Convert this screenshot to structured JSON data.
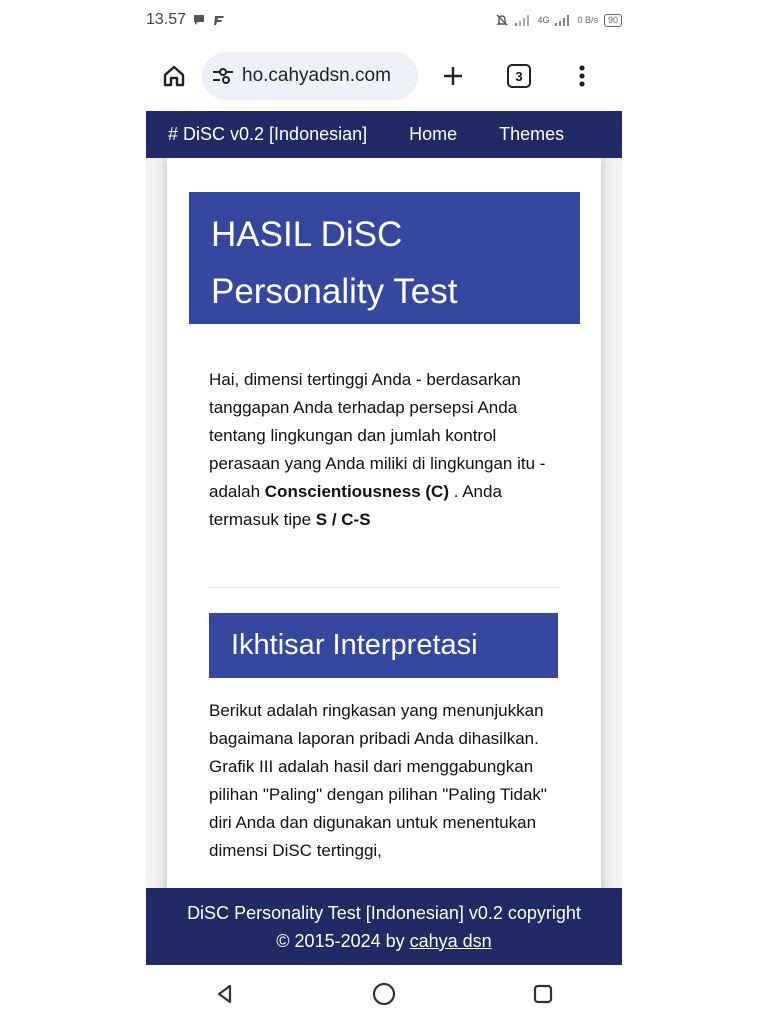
{
  "status_bar": {
    "time": "13.57",
    "right_text": "4G",
    "data_rate": "0 B/s",
    "battery": "90"
  },
  "browser": {
    "url": "ho.cahyadsn.com",
    "tab_count": "3"
  },
  "navbar": {
    "brand": "# DiSC v0.2 [Indonesian]",
    "home": "Home",
    "themes": "Themes"
  },
  "hero": {
    "line1": "HASIL DiSC",
    "line2": "Personality Test"
  },
  "intro": {
    "text_before": "Hai, dimensi tertinggi Anda - berdasarkan tanggapan Anda terhadap persepsi Anda tentang lingkungan dan jumlah kontrol perasaan yang Anda miliki di lingkungan itu - adalah ",
    "dimension": "Conscientiousness (C)",
    "text_middle": " . Anda termasuk tipe ",
    "type": "S / C-S"
  },
  "section": {
    "title": "Ikhtisar Interpretasi"
  },
  "summary": {
    "text": "Berikut adalah ringkasan yang menunjukkan bagaimana laporan pribadi Anda dihasilkan. Grafik III adalah hasil dari menggabungkan pilihan \"Paling\" dengan pilihan \"Paling Tidak\" diri Anda dan digunakan untuk menentukan dimensi DiSC tertinggi,"
  },
  "footer": {
    "line1": "DiSC Personality Test [Indonesian] v0.2 copyright",
    "line2_prefix": "© 2015-2024 by ",
    "author_link": "cahya dsn"
  }
}
